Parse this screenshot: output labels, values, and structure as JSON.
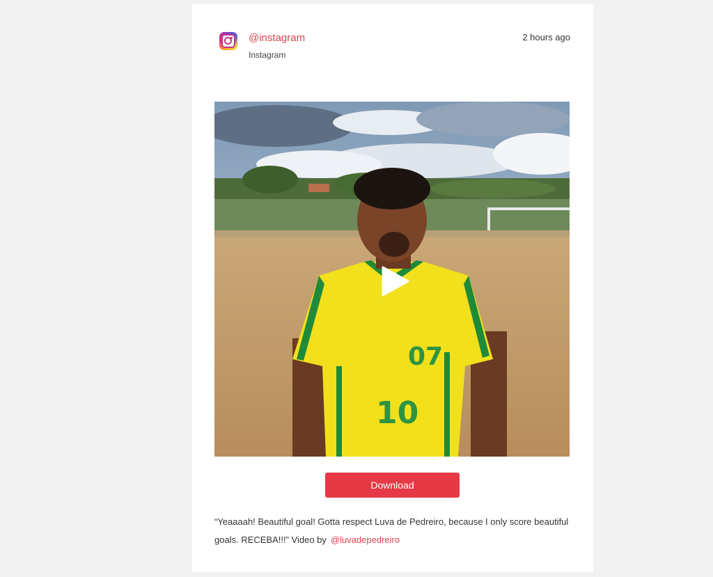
{
  "post": {
    "handle": "@instagram",
    "source": "Instagram",
    "time": "2 hours ago",
    "download_label": "Download",
    "caption": "“Yeaaaah! Beautiful goal! Gotta respect Luva de Pedreiro, because I only score beautiful goals. RECEBA!!!” Video by",
    "credit": "@luvadepedreiro"
  },
  "icons": {
    "logo": "instagram-icon",
    "play": "play-icon"
  },
  "colors": {
    "accent": "#e63946",
    "link": "#d9434e",
    "background": "#f2f2f2",
    "card": "#ffffff"
  }
}
